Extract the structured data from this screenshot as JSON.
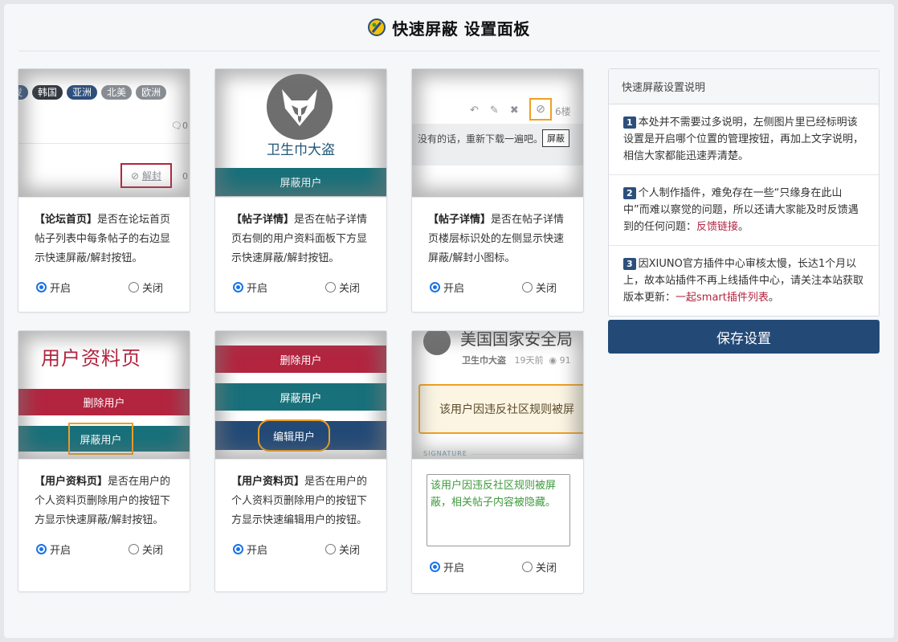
{
  "header": {
    "title": "快速屏蔽 设置面板"
  },
  "cards": [
    {
      "title": "【论坛首页】",
      "description": "是否在论坛首页帖子列表中每条帖子的右边显示快速屏蔽/解封按钮。",
      "thumb": {
        "tags": [
          {
            "label": "发",
            "color": "#2c4f7c"
          },
          {
            "label": "韩国",
            "color": "#333840"
          },
          {
            "label": "亚洲",
            "color": "#2c4f7c"
          },
          {
            "label": "北美",
            "color": "#888e94"
          },
          {
            "label": "欧洲",
            "color": "#888e94"
          }
        ],
        "count1": "0",
        "count2": "0",
        "button": "解封"
      },
      "on_label": "开启",
      "off_label": "关闭",
      "selected": "on"
    },
    {
      "title": "【帖子详情】",
      "description": "是否在帖子详情页右侧的用户资料面板下方显示快速屏蔽/解封按钮。",
      "thumb": {
        "username": "卫生巾大盗",
        "bar": "屏蔽用户"
      },
      "on_label": "开启",
      "off_label": "关闭",
      "selected": "on"
    },
    {
      "title": "【帖子详情】",
      "description": "是否在帖子详情页楼层标识处的左侧显示快速屏蔽/解封小图标。",
      "thumb": {
        "floor": "6楼",
        "text": "没有的话，重新下载一遍吧。",
        "tooltip": "屏蔽"
      },
      "on_label": "开启",
      "off_label": "关闭",
      "selected": "on"
    },
    {
      "title": "【用户资料页】",
      "description": "是否在用户的个人资料页删除用户的按钮下方显示快速屏蔽/解封按钮。",
      "thumb": {
        "heading": "用户资料页",
        "delete": "删除用户",
        "ban": "屏蔽用户"
      },
      "on_label": "开启",
      "off_label": "关闭",
      "selected": "on"
    },
    {
      "title": "【用户资料页】",
      "description": "是否在用户的个人资料页删除用户的按钮下方显示快速编辑用户的按钮。",
      "thumb": {
        "delete": "删除用户",
        "ban": "屏蔽用户",
        "edit": "编辑用户"
      },
      "on_label": "开启",
      "off_label": "关闭",
      "selected": "on"
    },
    {
      "thumb": {
        "title": "美国国家安全局",
        "author": "卫生巾大盗",
        "time": "19天前",
        "views": "91",
        "notice": "该用户因违反社区规则被屏",
        "signature_label": "SIGNATURE"
      },
      "textarea_value": "该用户因违反社区规则被屏蔽，相关帖子内容被隐藏。",
      "on_label": "开启",
      "off_label": "关闭",
      "selected": "on"
    }
  ],
  "info": {
    "heading": "快速屏蔽设置说明",
    "items": [
      {
        "num": "1",
        "text": "本处并不需要过多说明，左侧图片里已经标明该设置是开启哪个位置的管理按钮，再加上文字说明，相信大家都能迅速弄清楚。"
      },
      {
        "num": "2",
        "text": "个人制作插件，难免存在一些“只缘身在此山中”而难以察觉的问题，所以还请大家能及时反馈遇到的任何问题：",
        "link": "反馈链接",
        "end": "。"
      },
      {
        "num": "3",
        "text": "因XIUNO官方插件中心审核太慢，长达1个月以上，故本站插件不再上线插件中心，请关注本站获取版本更新：",
        "link": "一起smart插件列表",
        "end": "。"
      }
    ]
  },
  "save_button": "保存设置",
  "colors": {
    "primary": "#234a77",
    "accent_red": "#b3243f",
    "teal": "#17707a",
    "highlight": "#f0a020"
  }
}
